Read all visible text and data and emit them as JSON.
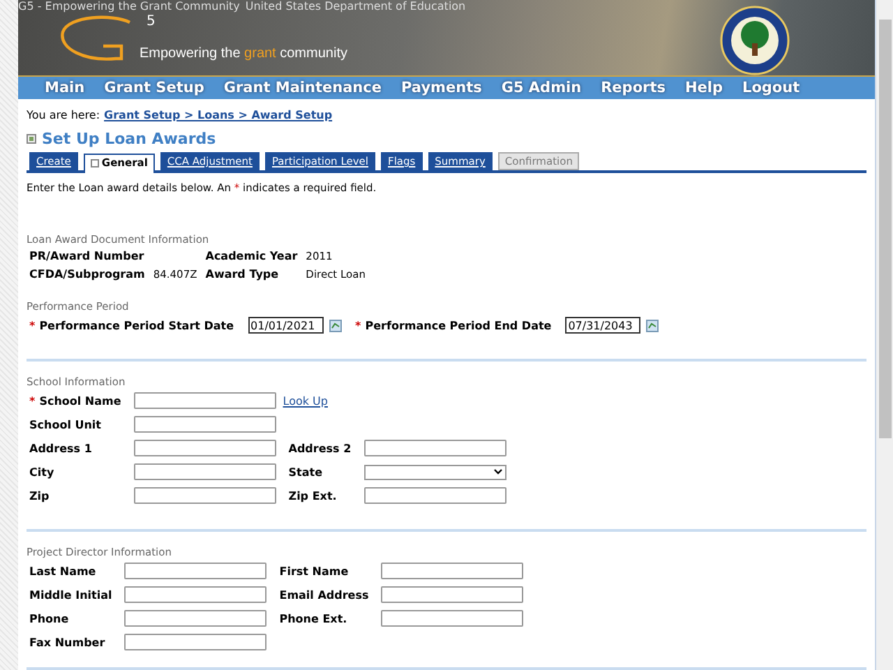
{
  "banner": {
    "image_alts": [
      "G5 - Empowering the Grant Community",
      "United States Department of Education"
    ],
    "logo_number": "5",
    "tagline": [
      "Empowering the ",
      "grant",
      " community"
    ]
  },
  "nav": [
    "Main",
    "Grant Setup",
    "Grant Maintenance",
    "Payments",
    "G5 Admin",
    "Reports",
    "Help",
    "Logout"
  ],
  "breadcrumb": {
    "label": "You are here:",
    "path": "Grant Setup > Loans > Award Setup"
  },
  "page_title": "Set Up Loan Awards",
  "tabs": [
    {
      "label": "Create",
      "selected": false,
      "disabled": false
    },
    {
      "label": "General",
      "selected": true,
      "disabled": false
    },
    {
      "label": "CCA Adjustment",
      "selected": false,
      "disabled": false
    },
    {
      "label": "Participation Level",
      "selected": false,
      "disabled": false
    },
    {
      "label": "Flags",
      "selected": false,
      "disabled": false
    },
    {
      "label": "Summary",
      "selected": false,
      "disabled": false
    },
    {
      "label": "Confirmation",
      "selected": false,
      "disabled": true
    }
  ],
  "instructions": [
    "Enter the Loan award details below. An ",
    "*",
    " indicates a required field."
  ],
  "document_info": {
    "heading": "Loan Award Document Information",
    "rows": [
      [
        {
          "label": "PR/Award Number"
        },
        {
          "label": "Academic Year",
          "value": "2011"
        }
      ],
      [
        {
          "label": "CFDA/Subprogram",
          "value": "84.407Z"
        },
        {
          "label": "Award Type",
          "value": "Direct Loan"
        }
      ]
    ]
  },
  "performance_period": {
    "heading": "Performance Period",
    "fields": [
      {
        "label": "Performance Period Start Date",
        "required": true,
        "value": "01/01/2021"
      },
      {
        "label": "Performance Period End Date",
        "required": true,
        "value": "07/31/2043"
      }
    ]
  },
  "sections": [
    {
      "heading": "School Information",
      "rows": [
        [
          {
            "label": "School Name",
            "required": true,
            "kind": "text",
            "link": "Look Up"
          }
        ],
        [
          {
            "label": "School Unit",
            "required": false,
            "kind": "text"
          }
        ],
        [
          {
            "label": "Address 1",
            "required": false,
            "kind": "text"
          },
          {
            "label": "Address 2",
            "required": false,
            "kind": "text"
          }
        ],
        [
          {
            "label": "City",
            "required": false,
            "kind": "text"
          },
          {
            "label": "State",
            "required": false,
            "kind": "select"
          }
        ],
        [
          {
            "label": "Zip",
            "required": false,
            "kind": "text"
          },
          {
            "label": "Zip Ext.",
            "required": false,
            "kind": "text"
          }
        ]
      ]
    },
    {
      "heading": "Project Director Information",
      "rows": [
        [
          {
            "label": "Last Name",
            "required": false,
            "kind": "text"
          },
          {
            "label": "First Name",
            "required": false,
            "kind": "text"
          }
        ],
        [
          {
            "label": "Middle Initial",
            "required": false,
            "kind": "text"
          },
          {
            "label": "Email Address",
            "required": false,
            "kind": "text"
          }
        ],
        [
          {
            "label": "Phone",
            "required": false,
            "kind": "text"
          },
          {
            "label": "Phone Ext.",
            "required": false,
            "kind": "text"
          }
        ],
        [
          {
            "label": "Fax Number",
            "required": false,
            "kind": "text"
          }
        ]
      ]
    }
  ]
}
